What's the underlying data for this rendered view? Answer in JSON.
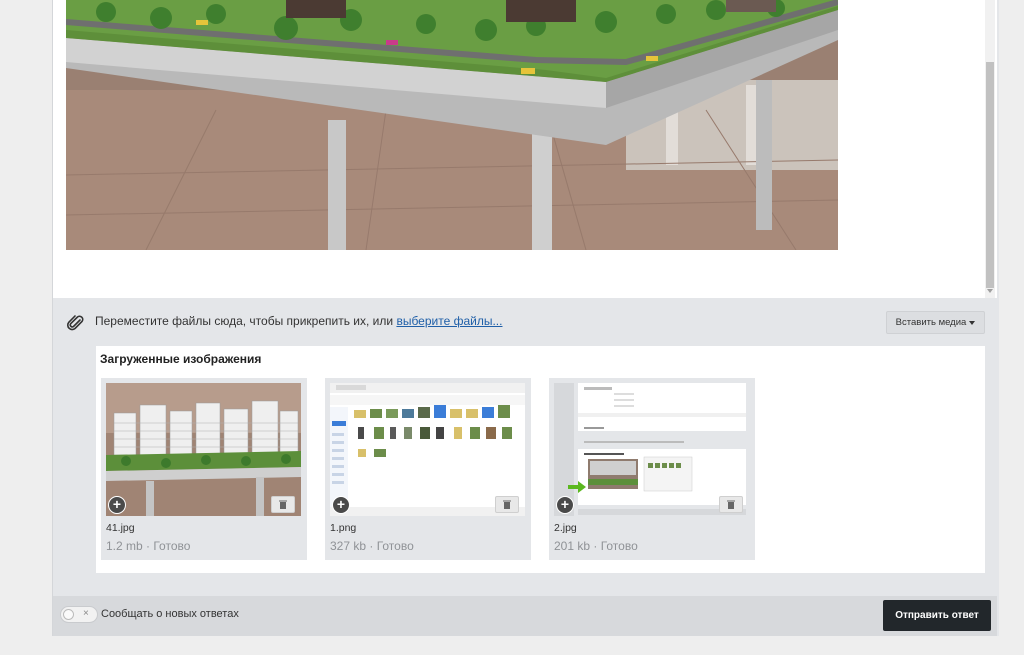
{
  "dropzone": {
    "text": "Переместите файлы сюда, чтобы прикрепить их, или",
    "link": "выберите файлы...",
    "insert_media": "Вставить медиа"
  },
  "uploads": {
    "title": "Загруженные изображения",
    "files": [
      {
        "name": "41.jpg",
        "size": "1.2 mb",
        "status": "Готово"
      },
      {
        "name": "1.png",
        "size": "327 kb",
        "status": "Готово"
      },
      {
        "name": "2.jpg",
        "size": "201 kb",
        "status": "Готово"
      }
    ],
    "separator": " · "
  },
  "footer": {
    "notify_label": "Сообщать о новых ответах",
    "send_button": "Отправить ответ"
  },
  "colors": {
    "send_button_bg": "#22272b",
    "link": "#1f5fa8",
    "panel_bg": "#e4e6e9",
    "green_arrow": "#5bb81f"
  },
  "icons": [
    "paperclip-icon",
    "plus-circle-icon",
    "trash-icon",
    "caret-down-icon",
    "toggle-x-icon"
  ]
}
